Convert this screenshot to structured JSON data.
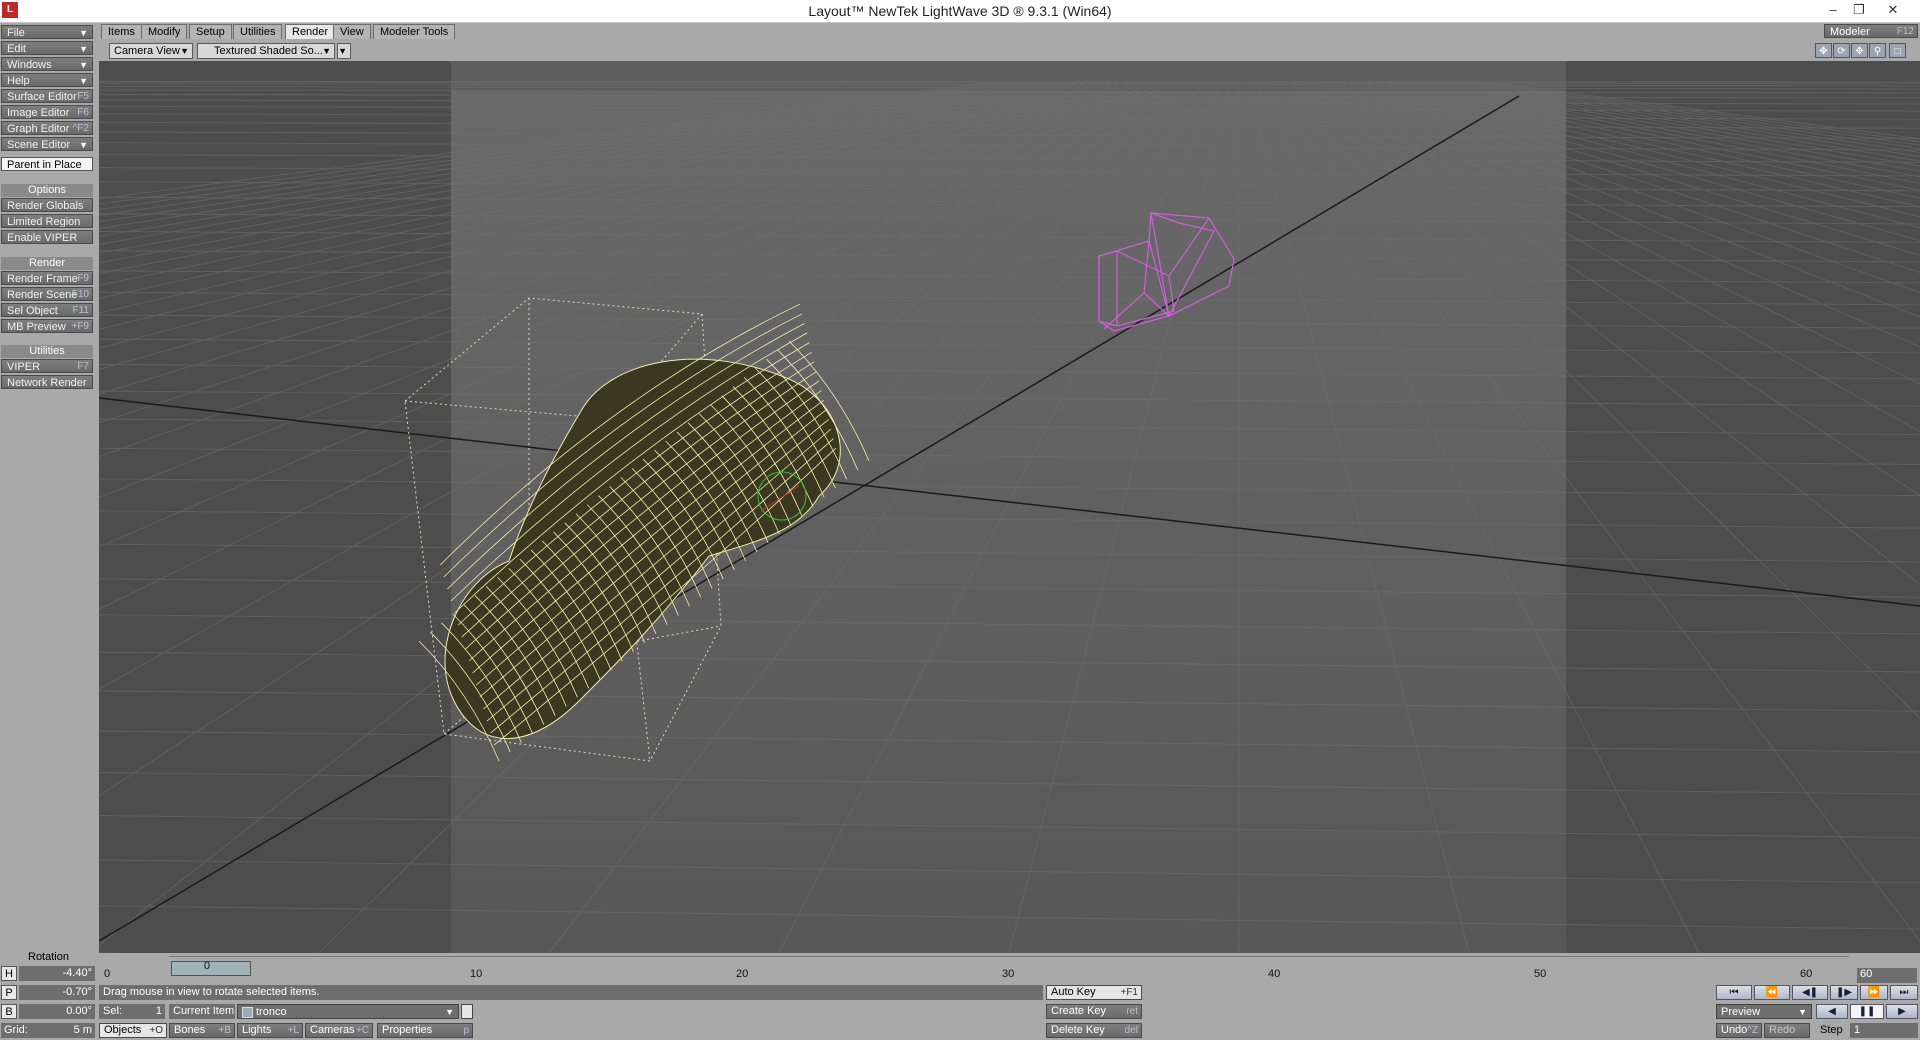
{
  "window": {
    "title": "Layout™ NewTek LightWave 3D ® 9.3.1 (Win64)",
    "app_icon": "lightwave-icon",
    "minimize": "–",
    "restore": "❐",
    "close": "✕"
  },
  "left_menu": {
    "file": "File",
    "edit": "Edit",
    "windows": "Windows",
    "help": "Help",
    "surface_editor": {
      "label": "Surface Editor",
      "shortcut": "F5"
    },
    "image_editor": {
      "label": "Image Editor",
      "shortcut": "F6"
    },
    "graph_editor": {
      "label": "Graph Editor",
      "shortcut": "^F2"
    },
    "scene_editor": "Scene Editor",
    "parent_in_place": "Parent in Place",
    "options_header": "Options",
    "render_globals": "Render Globals",
    "limited_region": "Limited Region",
    "enable_viper": "Enable VIPER",
    "render_header": "Render",
    "render_frame": {
      "label": "Render Frame",
      "shortcut": "F9"
    },
    "render_scene": {
      "label": "Render Scene",
      "shortcut": "F10"
    },
    "sel_object": {
      "label": "Sel Object",
      "shortcut": "F11"
    },
    "mb_preview": {
      "label": "MB Preview",
      "shortcut": "+F9"
    },
    "utilities_header": "Utilities",
    "viper": {
      "label": "VIPER",
      "shortcut": "F7"
    },
    "network_render": "Network Render",
    "rotation_label": "Rotation"
  },
  "tabs": [
    "Items",
    "Modify",
    "Setup",
    "Utilities",
    "Render",
    "View",
    "Modeler Tools"
  ],
  "active_tab": "Render",
  "modeler_button": {
    "label": "Modeler",
    "shortcut": "F12"
  },
  "view": {
    "camera_view": "Camera View",
    "shading": "Textured Shaded So..."
  },
  "timeline": {
    "ticks": [
      "0",
      "10",
      "20",
      "30",
      "40",
      "50",
      "60"
    ],
    "start": "0",
    "end": "60",
    "current": "0"
  },
  "coords": {
    "h": {
      "label": "H",
      "value": "-4.40°"
    },
    "p": {
      "label": "P",
      "value": "-0.70°"
    },
    "b": {
      "label": "B",
      "value": "0.00°"
    },
    "grid_label": "Grid:",
    "grid_value": "5 m"
  },
  "status": {
    "message": "Drag mouse in view to rotate selected items.",
    "sel_label": "Sel:",
    "sel_value": "1",
    "current_item_label": "Current Item",
    "current_item_value": "tronco"
  },
  "item_buttons": {
    "objects": {
      "label": "Objects",
      "shortcut": "+O"
    },
    "bones": {
      "label": "Bones",
      "shortcut": "+B"
    },
    "lights": {
      "label": "Lights",
      "shortcut": "+L"
    },
    "cameras": {
      "label": "Cameras",
      "shortcut": "+C"
    },
    "properties": {
      "label": "Properties",
      "shortcut": "p"
    }
  },
  "keys": {
    "auto_key": {
      "label": "Auto Key",
      "shortcut": "+F1"
    },
    "create_key": {
      "label": "Create Key",
      "shortcut": "ret"
    },
    "delete_key": {
      "label": "Delete Key",
      "shortcut": "del"
    }
  },
  "playback": {
    "preview": "Preview",
    "undo": "Undo",
    "undo_shortcut": "^Z",
    "redo": "Redo",
    "step_label": "Step",
    "step_value": "1"
  },
  "colors": {
    "wireframe": "#f5eeae",
    "camera": "#d060d8",
    "viewport_bg": "#555555"
  }
}
